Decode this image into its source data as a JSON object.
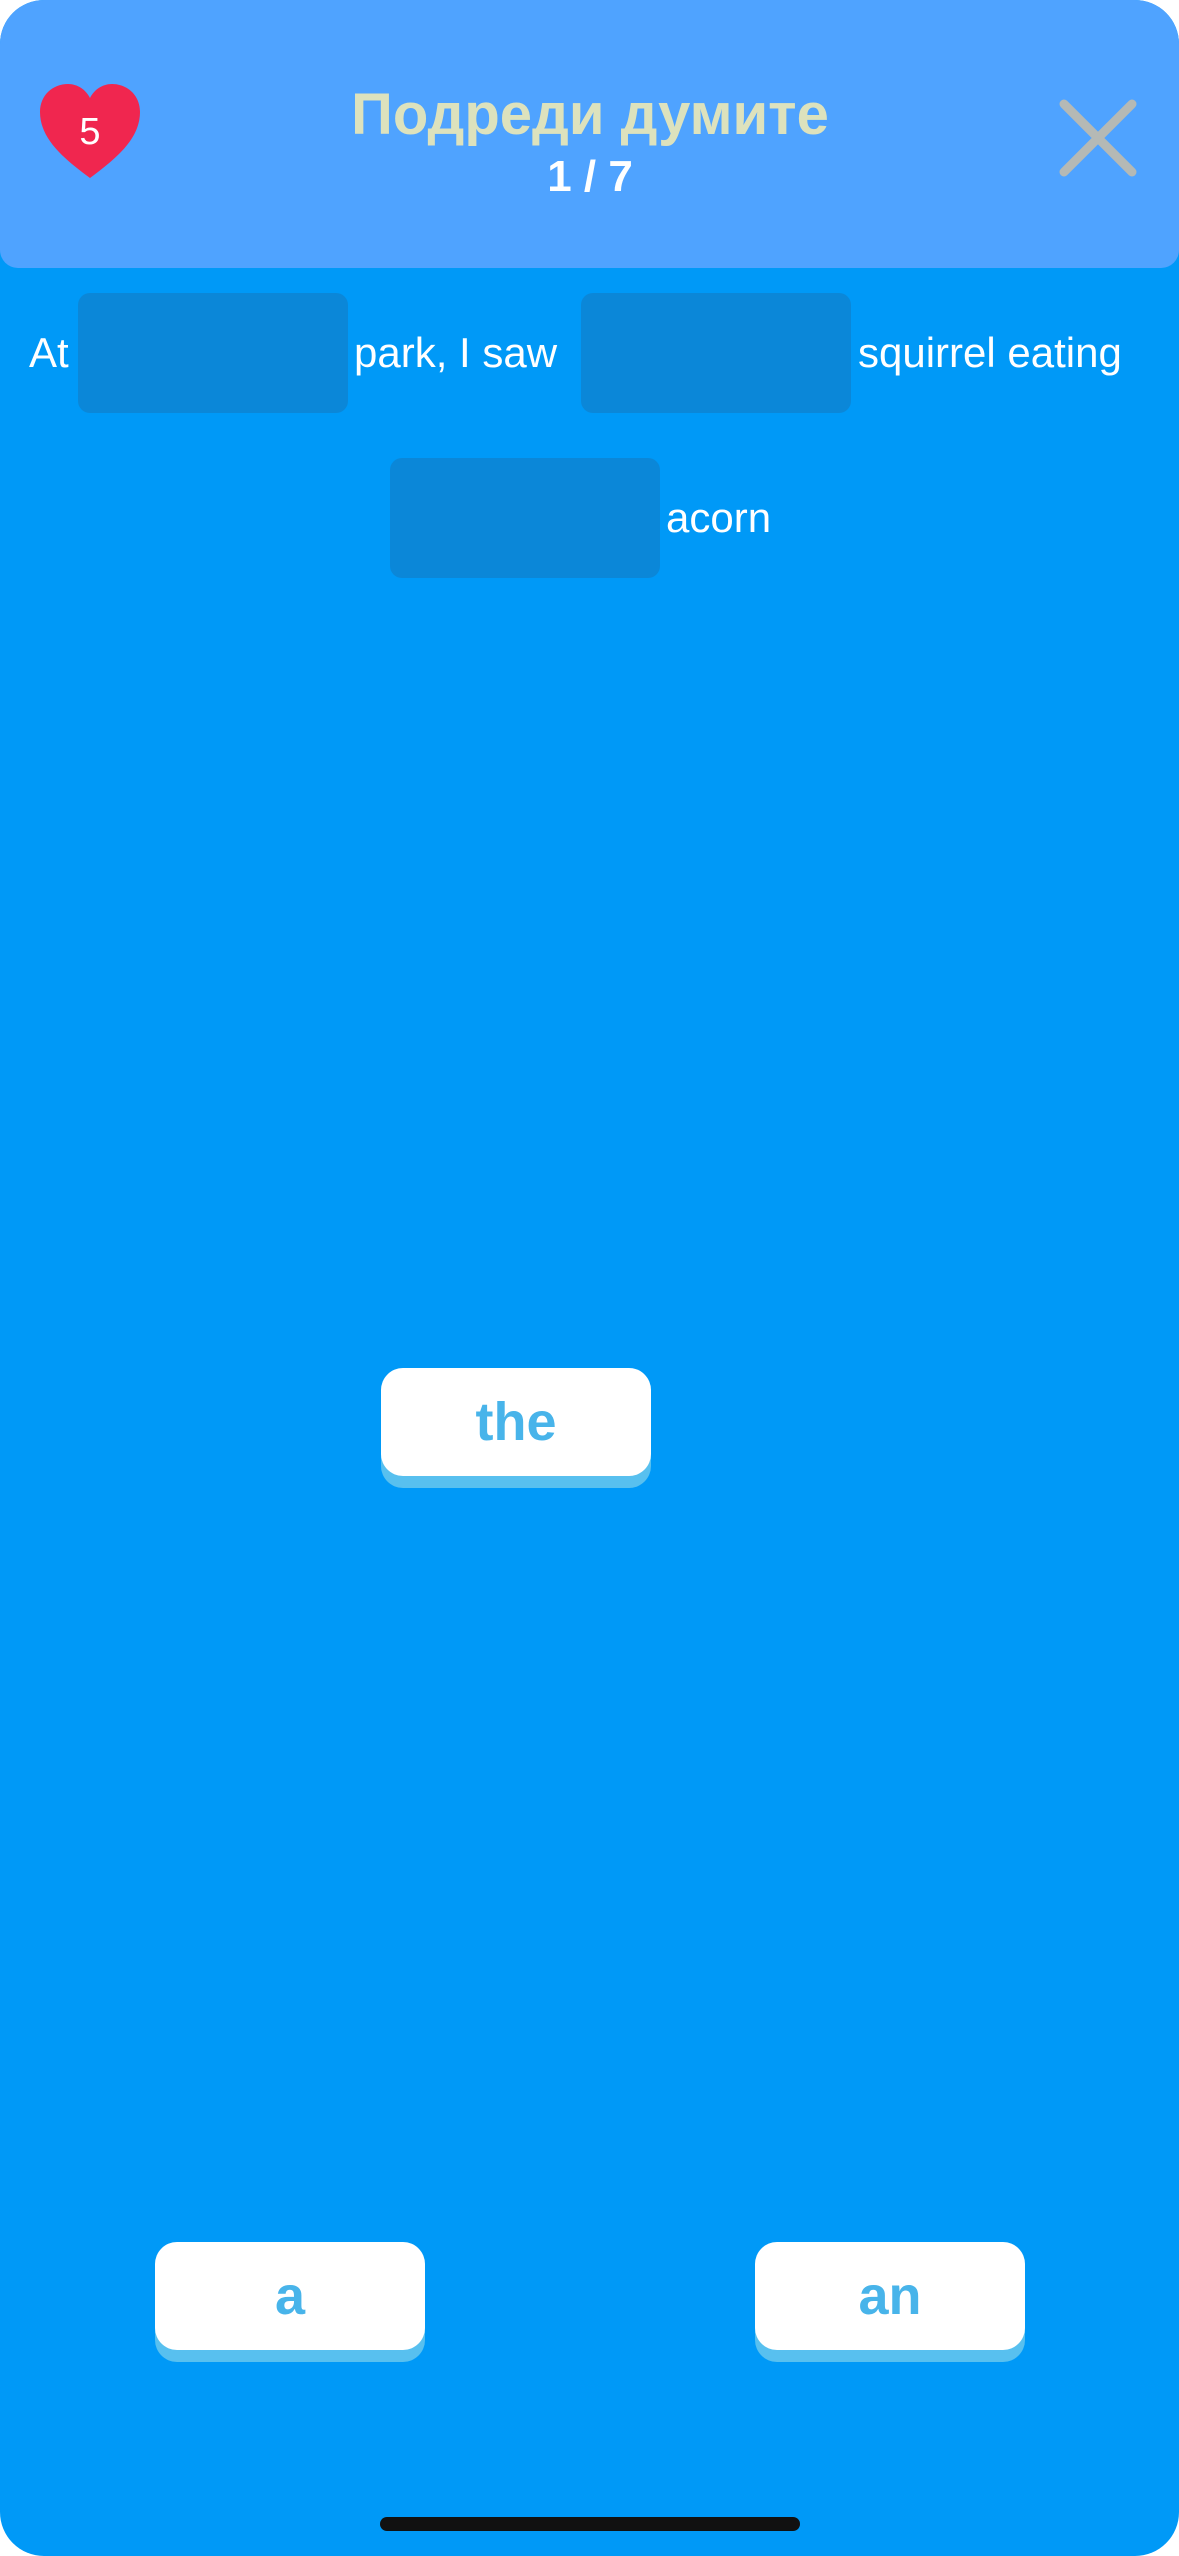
{
  "header": {
    "lives": "5",
    "title": "Подреди думите",
    "progress": "1 / 7"
  },
  "sentence": {
    "words": [
      "At",
      "park, I saw",
      "squirrel eating",
      "acorn"
    ],
    "blanks_count": 3
  },
  "options": {
    "tile_1": "the",
    "tile_2": "a",
    "tile_3": "an"
  },
  "colors": {
    "background": "#0099f7",
    "header": "#4fa3ff",
    "title": "#dde2bd",
    "heart": "#f0264f",
    "slot": "#0b87d8",
    "tile_text": "#48b4ea",
    "tile_shadow": "#58c0ef"
  },
  "icons": {
    "lives": "heart-icon",
    "close": "close-x-icon"
  }
}
